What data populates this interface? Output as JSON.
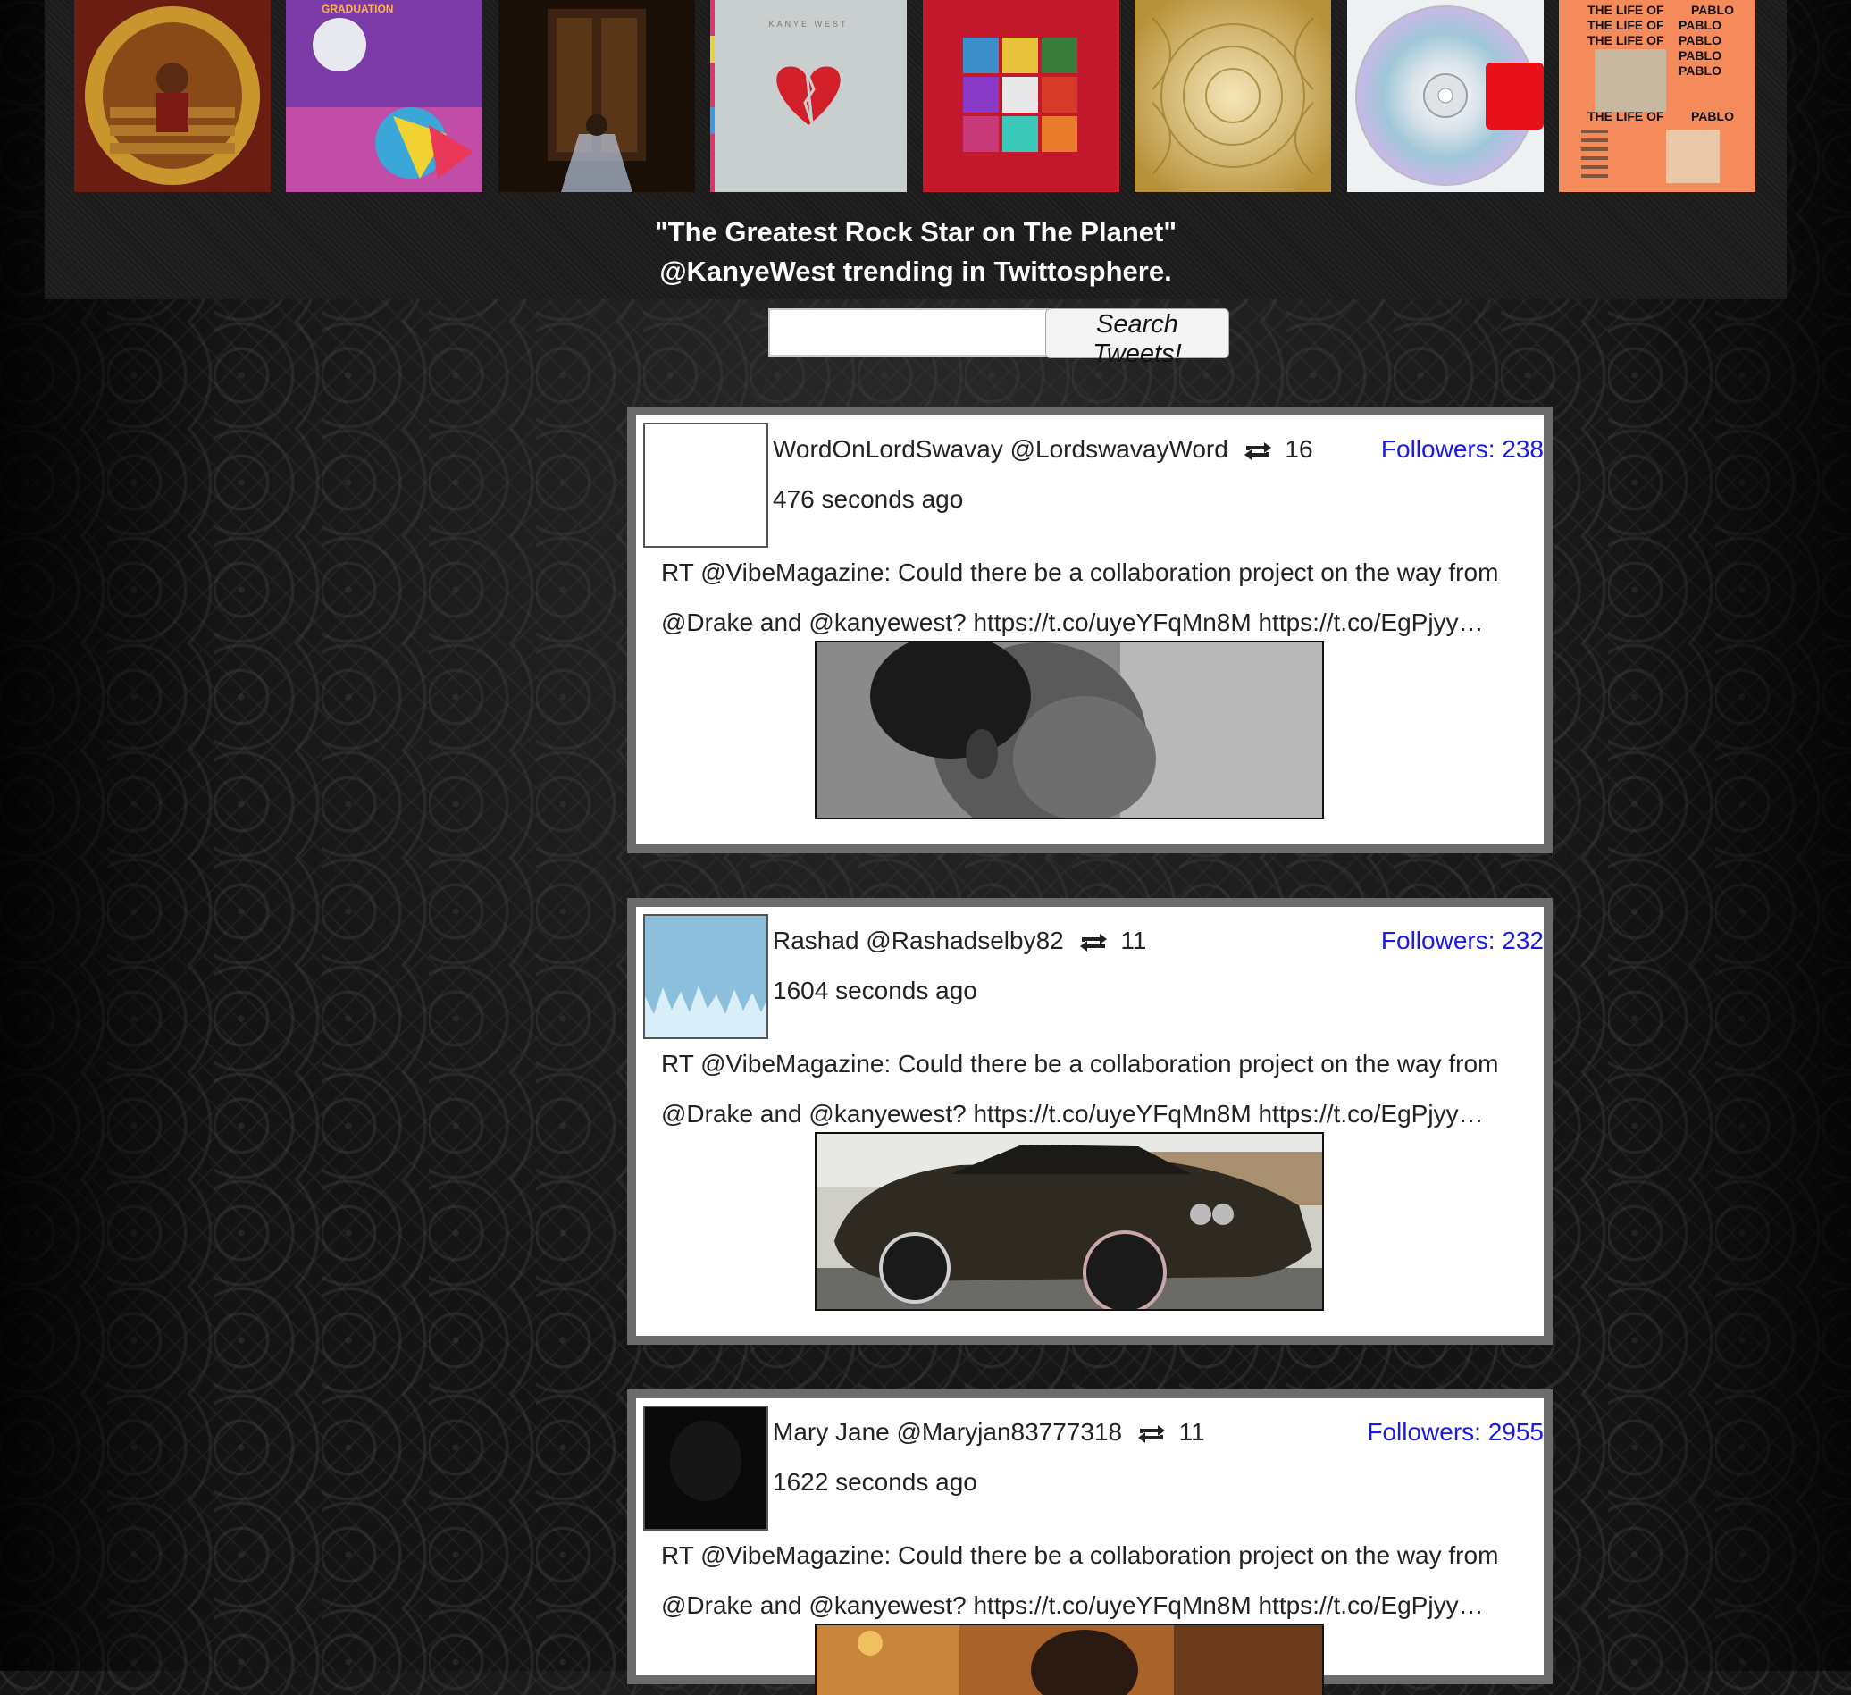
{
  "header": {
    "tagline_line1": "\"The Greatest Rock Star on The Planet\"",
    "tagline_line2": "@KanyeWest trending in Twittosphere.",
    "covers": [
      {
        "name": "the-college-dropout-cover"
      },
      {
        "name": "graduation-cover",
        "text": "GRADUATION"
      },
      {
        "name": "late-registration-cover"
      },
      {
        "name": "808s-heartbreak-cover",
        "text": "KANYE WEST"
      },
      {
        "name": "my-beautiful-dark-twisted-fantasy-cover"
      },
      {
        "name": "watch-the-throne-cover"
      },
      {
        "name": "yeezus-cover"
      },
      {
        "name": "the-life-of-pablo-cover",
        "text_left": "THE LIFE OF",
        "text_right": "PABLO"
      }
    ]
  },
  "search": {
    "input_value": "",
    "button_label": "Search Tweets!"
  },
  "tweets": [
    {
      "name": "WordOnLordSwavay",
      "handle": "@LordswavayWord",
      "retweets": "16",
      "followers": "Followers: 238",
      "time": "476 seconds ago",
      "text": "RT @VibeMagazine: Could there be a collaboration project on the way from @Drake and @kanyewest? https://t.co/uyeYFqMn8M https://t.co/EgPjyy…",
      "media": "portrait-photo"
    },
    {
      "name": "Rashad",
      "handle": "@Rashadselby82",
      "retweets": "11",
      "followers": "Followers: 232",
      "time": "1604 seconds ago",
      "text": "RT @VibeMagazine: Could there be a collaboration project on the way from @Drake and @kanyewest? https://t.co/uyeYFqMn8M https://t.co/EgPjyy…",
      "media": "car-photo"
    },
    {
      "name": "Mary Jane",
      "handle": "@Maryjan83777318",
      "retweets": "11",
      "followers": "Followers: 2955",
      "time": "1622 seconds ago",
      "text": "RT @VibeMagazine: Could there be a collaboration project on the way from @Drake and @kanyewest? https://t.co/uyeYFqMn8M https://t.co/EgPjyy…",
      "media": "room-photo"
    }
  ],
  "colors": {
    "followers_link": "#1a1ae6",
    "tweet_border": "#6c6c6c",
    "header_bg": "#1b1b1b"
  },
  "icons": {
    "retweet": "retweet-icon"
  }
}
